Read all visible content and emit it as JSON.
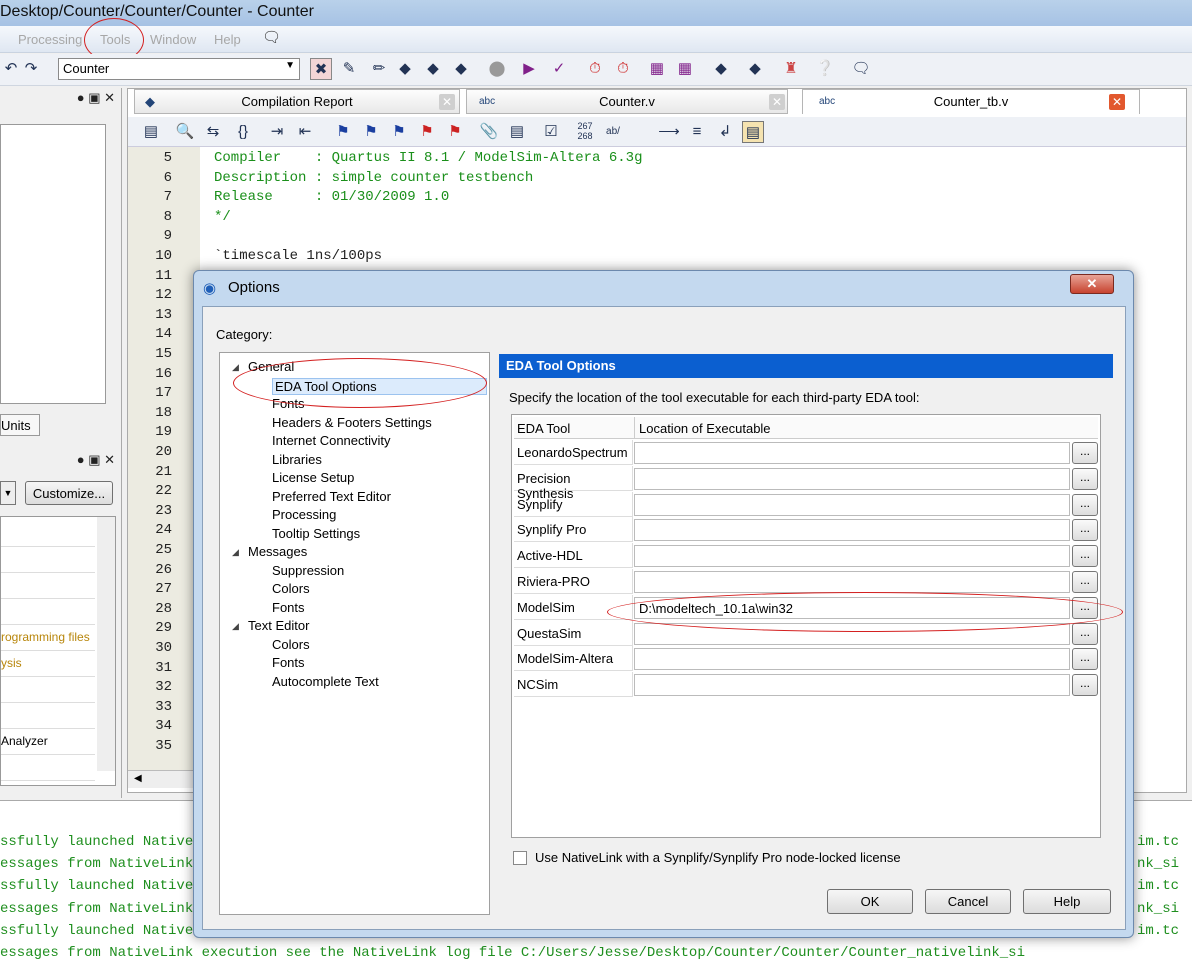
{
  "window": {
    "title": "Desktop/Counter/Counter/Counter - Counter"
  },
  "menu": [
    "Processing",
    "Tools",
    "Window",
    "Help"
  ],
  "toolbar": {
    "project": "Counter"
  },
  "left": {
    "units_tab": "Units",
    "customize": "Customize...",
    "tasks": [
      "",
      "",
      "",
      "",
      "rogramming files",
      "ysis",
      "",
      "",
      "Analyzer",
      ""
    ]
  },
  "tabs": [
    {
      "label": "Compilation Report"
    },
    {
      "label": "Counter.v"
    },
    {
      "label": "Counter_tb.v"
    }
  ],
  "editor": {
    "line_numbers": [
      "5",
      "6",
      "7",
      "8",
      "9",
      "10",
      "11",
      "12",
      "13",
      "14",
      "15",
      "16",
      "17",
      "18",
      "19",
      "20",
      "21",
      "22",
      "23",
      "24",
      "25",
      "26",
      "27",
      "28",
      "29",
      "30",
      "31",
      "32",
      "33",
      "34",
      "35"
    ],
    "code": [
      "Compiler    : Quartus II 8.1 / ModelSim-Altera 6.3g",
      "Description : simple counter testbench",
      "Release     : 01/30/2009 1.0",
      "*/",
      "",
      "`timescale 1ns/100ps"
    ]
  },
  "messages": [
    "ssfully launched NativeLink simulation",
    "essages from NativeLink execution see the NativeLink log file",
    "ssfully launched NativeLink simulation",
    "essages from NativeLink execution see the NativeLink log file",
    "ssfully launched NativeLink simulation",
    "essages from NativeLink execution see the NativeLink log file C:/Users/Jesse/Desktop/Counter/Counter/Counter_nativelink_si"
  ],
  "messages_right": [
    "im.tc",
    "nk_si",
    "im.tc",
    "nk_si",
    "im.tc"
  ],
  "dialog": {
    "title": "Options",
    "category_label": "Category:",
    "tree": [
      {
        "label": "General",
        "level": 0
      },
      {
        "label": "EDA Tool Options",
        "level": 1,
        "selected": true
      },
      {
        "label": "Fonts",
        "level": 1
      },
      {
        "label": "Headers & Footers Settings",
        "level": 1
      },
      {
        "label": "Internet Connectivity",
        "level": 1
      },
      {
        "label": "Libraries",
        "level": 1
      },
      {
        "label": "License Setup",
        "level": 1
      },
      {
        "label": "Preferred Text Editor",
        "level": 1
      },
      {
        "label": "Processing",
        "level": 1
      },
      {
        "label": "Tooltip Settings",
        "level": 1
      },
      {
        "label": "Messages",
        "level": 0
      },
      {
        "label": "Suppression",
        "level": 1
      },
      {
        "label": "Colors",
        "level": 1
      },
      {
        "label": "Fonts",
        "level": 1
      },
      {
        "label": "Text Editor",
        "level": 0
      },
      {
        "label": "Colors",
        "level": 1
      },
      {
        "label": "Fonts",
        "level": 1
      },
      {
        "label": "Autocomplete Text",
        "level": 1
      }
    ],
    "panel_title": "EDA Tool Options",
    "description": "Specify the location of the tool executable for each third-party EDA tool:",
    "columns": [
      "EDA Tool",
      "Location of Executable"
    ],
    "rows": [
      {
        "tool": "LeonardoSpectrum",
        "path": ""
      },
      {
        "tool": "Precision Synthesis",
        "path": ""
      },
      {
        "tool": "Synplify",
        "path": ""
      },
      {
        "tool": "Synplify Pro",
        "path": ""
      },
      {
        "tool": "Active-HDL",
        "path": ""
      },
      {
        "tool": "Riviera-PRO",
        "path": ""
      },
      {
        "tool": "ModelSim",
        "path": "D:\\modeltech_10.1a\\win32"
      },
      {
        "tool": "QuestaSim",
        "path": ""
      },
      {
        "tool": "ModelSim-Altera",
        "path": ""
      },
      {
        "tool": "NCSim",
        "path": ""
      }
    ],
    "browse": "...",
    "nativelink": "Use NativeLink with a Synplify/Synplify Pro node-locked license",
    "ok": "OK",
    "cancel": "Cancel",
    "help": "Help"
  }
}
